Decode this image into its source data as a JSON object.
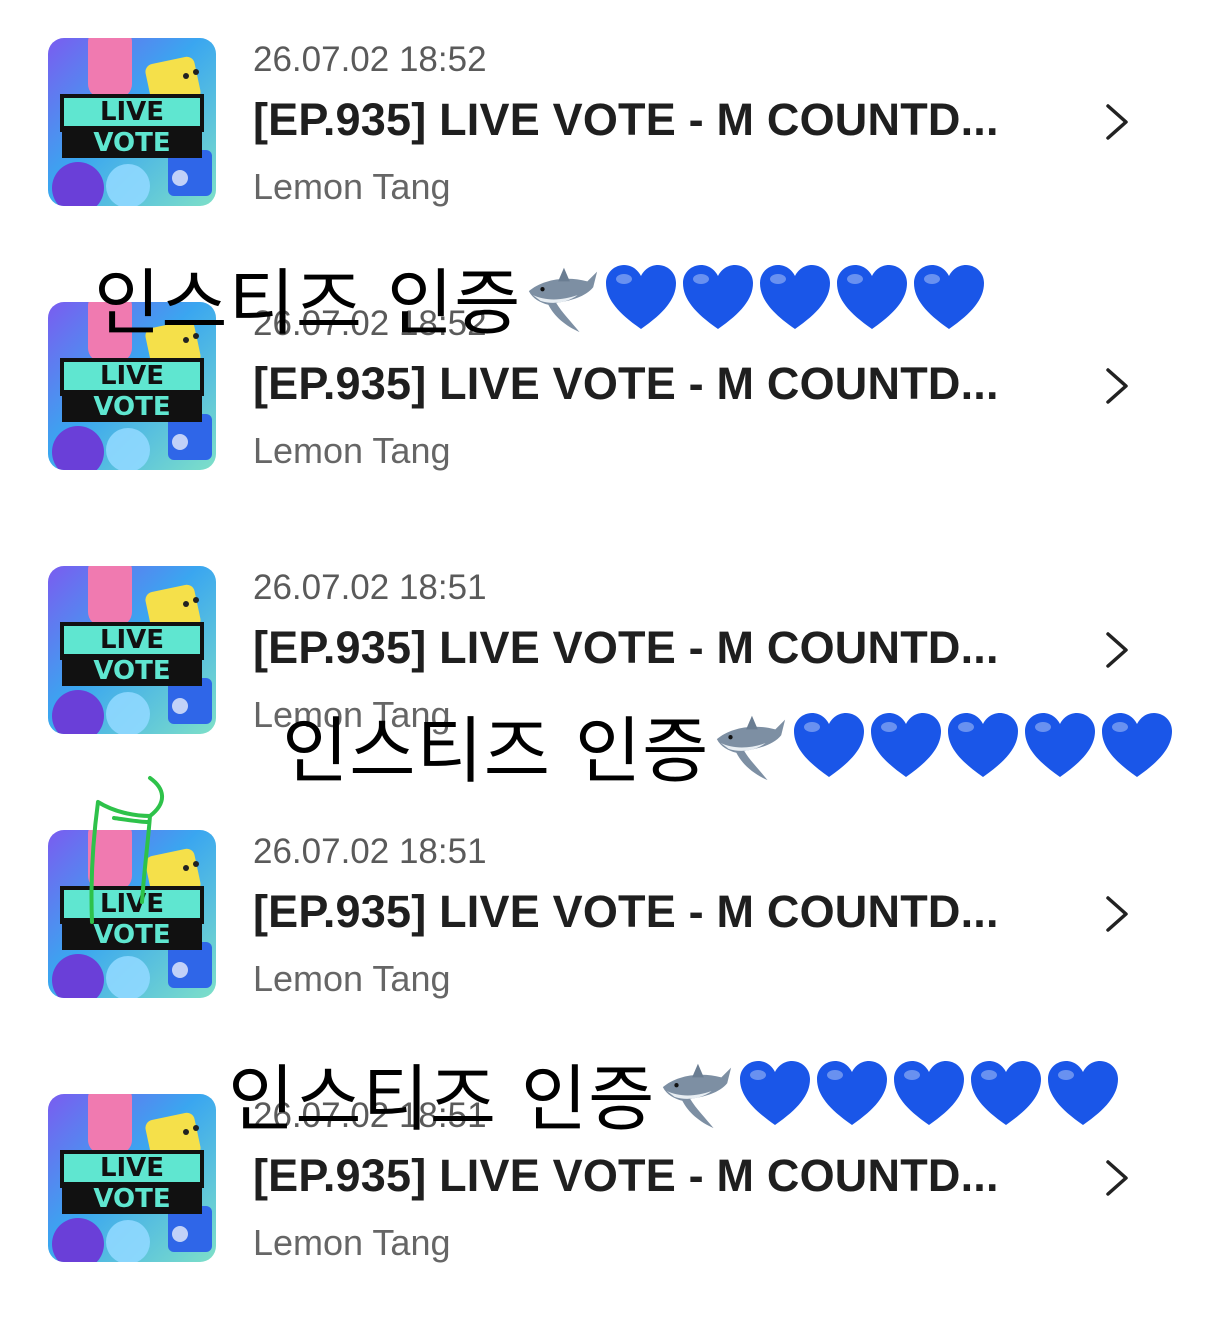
{
  "list": {
    "items": [
      {
        "date": "26.07.02 18:52",
        "title": "[EP.935] LIVE VOTE - M COUNTD...",
        "author": "Lemon Tang",
        "thumb_line1": "LIVE",
        "thumb_line2": "VOTE"
      },
      {
        "date": "26.07.02 18:52",
        "title": "[EP.935] LIVE VOTE - M COUNTD...",
        "author": "Lemon Tang",
        "thumb_line1": "LIVE",
        "thumb_line2": "VOTE"
      },
      {
        "date": "26.07.02 18:51",
        "title": "[EP.935] LIVE VOTE - M COUNTD...",
        "author": "Lemon Tang",
        "thumb_line1": "LIVE",
        "thumb_line2": "VOTE"
      },
      {
        "date": "26.07.02 18:51",
        "title": "[EP.935] LIVE VOTE - M COUNTD...",
        "author": "Lemon Tang",
        "thumb_line1": "LIVE",
        "thumb_line2": "VOTE"
      },
      {
        "date": "26.07.02 18:51",
        "title": "[EP.935] LIVE VOTE - M COUNTD...",
        "author": "Lemon Tang",
        "thumb_line1": "LIVE",
        "thumb_line2": "VOTE"
      }
    ]
  },
  "overlays": [
    {
      "text": "인스티즈 인증",
      "emoji": [
        "shark-icon",
        "blue-heart-icon",
        "blue-heart-icon",
        "blue-heart-icon",
        "blue-heart-icon",
        "blue-heart-icon"
      ]
    },
    {
      "text": "인스티즈 인증",
      "emoji": [
        "shark-icon",
        "blue-heart-icon",
        "blue-heart-icon",
        "blue-heart-icon",
        "blue-heart-icon",
        "blue-heart-icon"
      ]
    },
    {
      "text": "인스티즈 인증",
      "emoji": [
        "shark-icon",
        "blue-heart-icon",
        "blue-heart-icon",
        "blue-heart-icon",
        "blue-heart-icon",
        "blue-heart-icon"
      ]
    }
  ],
  "colors": {
    "heart": "#1a56e8",
    "scribble": "#2ec24a",
    "thumb_teal": "#5fe6d0",
    "thumb_bg": "#3aa6f0"
  }
}
